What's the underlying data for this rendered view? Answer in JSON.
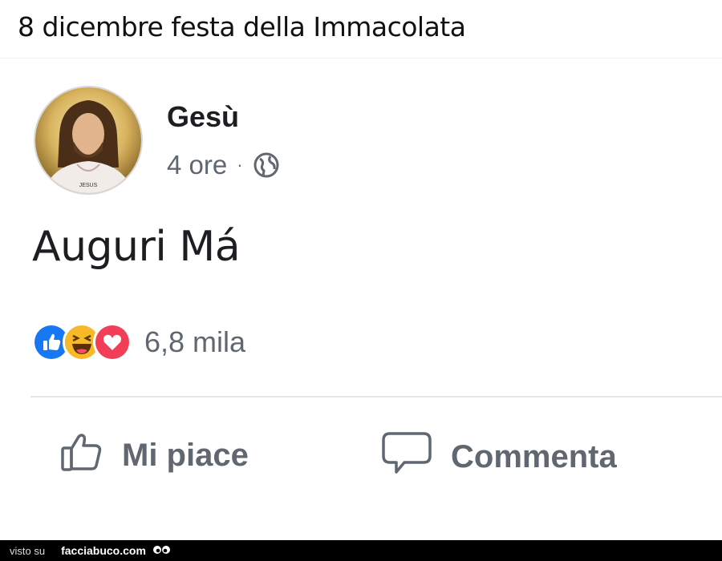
{
  "caption": "8 dicembre festa della Immacolata",
  "post": {
    "author": "Gesù",
    "time": "4 ore",
    "separator": "·",
    "text": "Auguri Má",
    "avatar_label": "JESUS"
  },
  "reactions": {
    "types": [
      "like",
      "haha",
      "love"
    ],
    "count": "6,8 mila",
    "colors": {
      "like": "#1877f2",
      "haha": "#f7b928",
      "love": "#f33e58"
    }
  },
  "actions": {
    "like_label": "Mi piace",
    "comment_label": "Commenta"
  },
  "footer": {
    "prefix": "visto su",
    "brand": "facciabuco.com"
  },
  "icons": [
    "globe-icon",
    "like-reaction-icon",
    "haha-reaction-icon",
    "love-reaction-icon",
    "thumbs-up-icon",
    "comment-bubble-icon",
    "eyes-logo-icon"
  ]
}
